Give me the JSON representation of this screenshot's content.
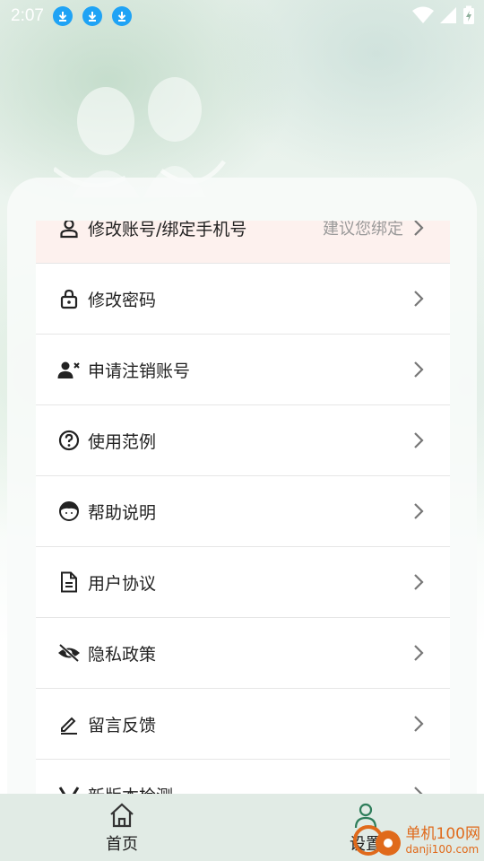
{
  "status_bar": {
    "time": "2:07",
    "notification_icons": [
      "download-icon",
      "download-icon",
      "download-icon"
    ],
    "right_icons": [
      "wifi-icon",
      "signal-icon",
      "battery-charging-icon"
    ]
  },
  "settings_list": [
    {
      "label": "修改账号/绑定手机号",
      "hint": "建议您绑定",
      "icon": "user-icon",
      "highlighted": true
    },
    {
      "label": "修改密码",
      "hint": "",
      "icon": "lock-icon",
      "highlighted": false
    },
    {
      "label": "申请注销账号",
      "hint": "",
      "icon": "user-remove-icon",
      "highlighted": false
    },
    {
      "label": "使用范例",
      "hint": "",
      "icon": "question-icon",
      "highlighted": false
    },
    {
      "label": "帮助说明",
      "hint": "",
      "icon": "help-face-icon",
      "highlighted": false
    },
    {
      "label": "用户协议",
      "hint": "",
      "icon": "document-icon",
      "highlighted": false
    },
    {
      "label": "隐私政策",
      "hint": "",
      "icon": "eye-off-icon",
      "highlighted": false
    },
    {
      "label": "留言反馈",
      "hint": "",
      "icon": "edit-icon",
      "highlighted": false
    },
    {
      "label": "新版本检测",
      "hint": "",
      "icon": "version-icon",
      "highlighted": false
    }
  ],
  "tab_bar": {
    "home_label": "首页",
    "settings_label": "设置",
    "home_icon": "home-icon",
    "settings_icon": "person-settings-icon"
  },
  "watermark": {
    "main": "单机100网",
    "sub": "danji100.com"
  },
  "colors": {
    "accent_download": "#1fa3f5",
    "highlight_row": "#fdf1ee",
    "tab_bar": "#e1ebe5",
    "watermark": "#e06a1b"
  }
}
